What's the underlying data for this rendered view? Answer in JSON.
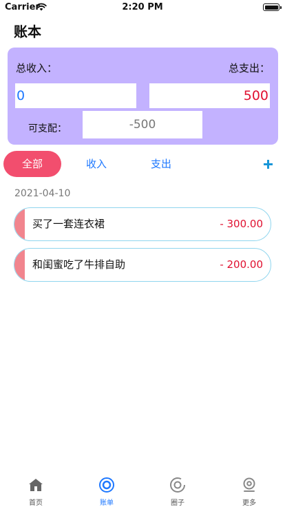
{
  "status_bar": {
    "carrier": "Carrier",
    "time": "2:20 PM"
  },
  "header": {
    "title": "账本"
  },
  "summary": {
    "income_label": "总收入：",
    "expense_label": "总支出：",
    "income_value": "0",
    "expense_value": "500",
    "balance_label": "可支配：",
    "balance_value": "-500"
  },
  "filters": {
    "all": "全部",
    "income": "收入",
    "expense": "支出"
  },
  "groups": [
    {
      "date": "2021-04-10",
      "records": [
        {
          "desc": "买了一套连衣裙",
          "amount": "- 300.00"
        },
        {
          "desc": "和闺蜜吃了牛排自助",
          "amount": "- 200.00"
        }
      ]
    }
  ],
  "tabs": [
    {
      "label": "首页",
      "icon": "home-icon"
    },
    {
      "label": "账单",
      "icon": "bill-icon"
    },
    {
      "label": "圈子",
      "icon": "circle-icon"
    },
    {
      "label": "更多",
      "icon": "more-icon"
    }
  ],
  "colors": {
    "card": "#c3b2ff",
    "accent_pink": "#f24e6e",
    "link_blue": "#1e78ff",
    "expense_red": "#e01030",
    "record_border": "#8fd5ee",
    "record_marker": "#f1858e"
  }
}
